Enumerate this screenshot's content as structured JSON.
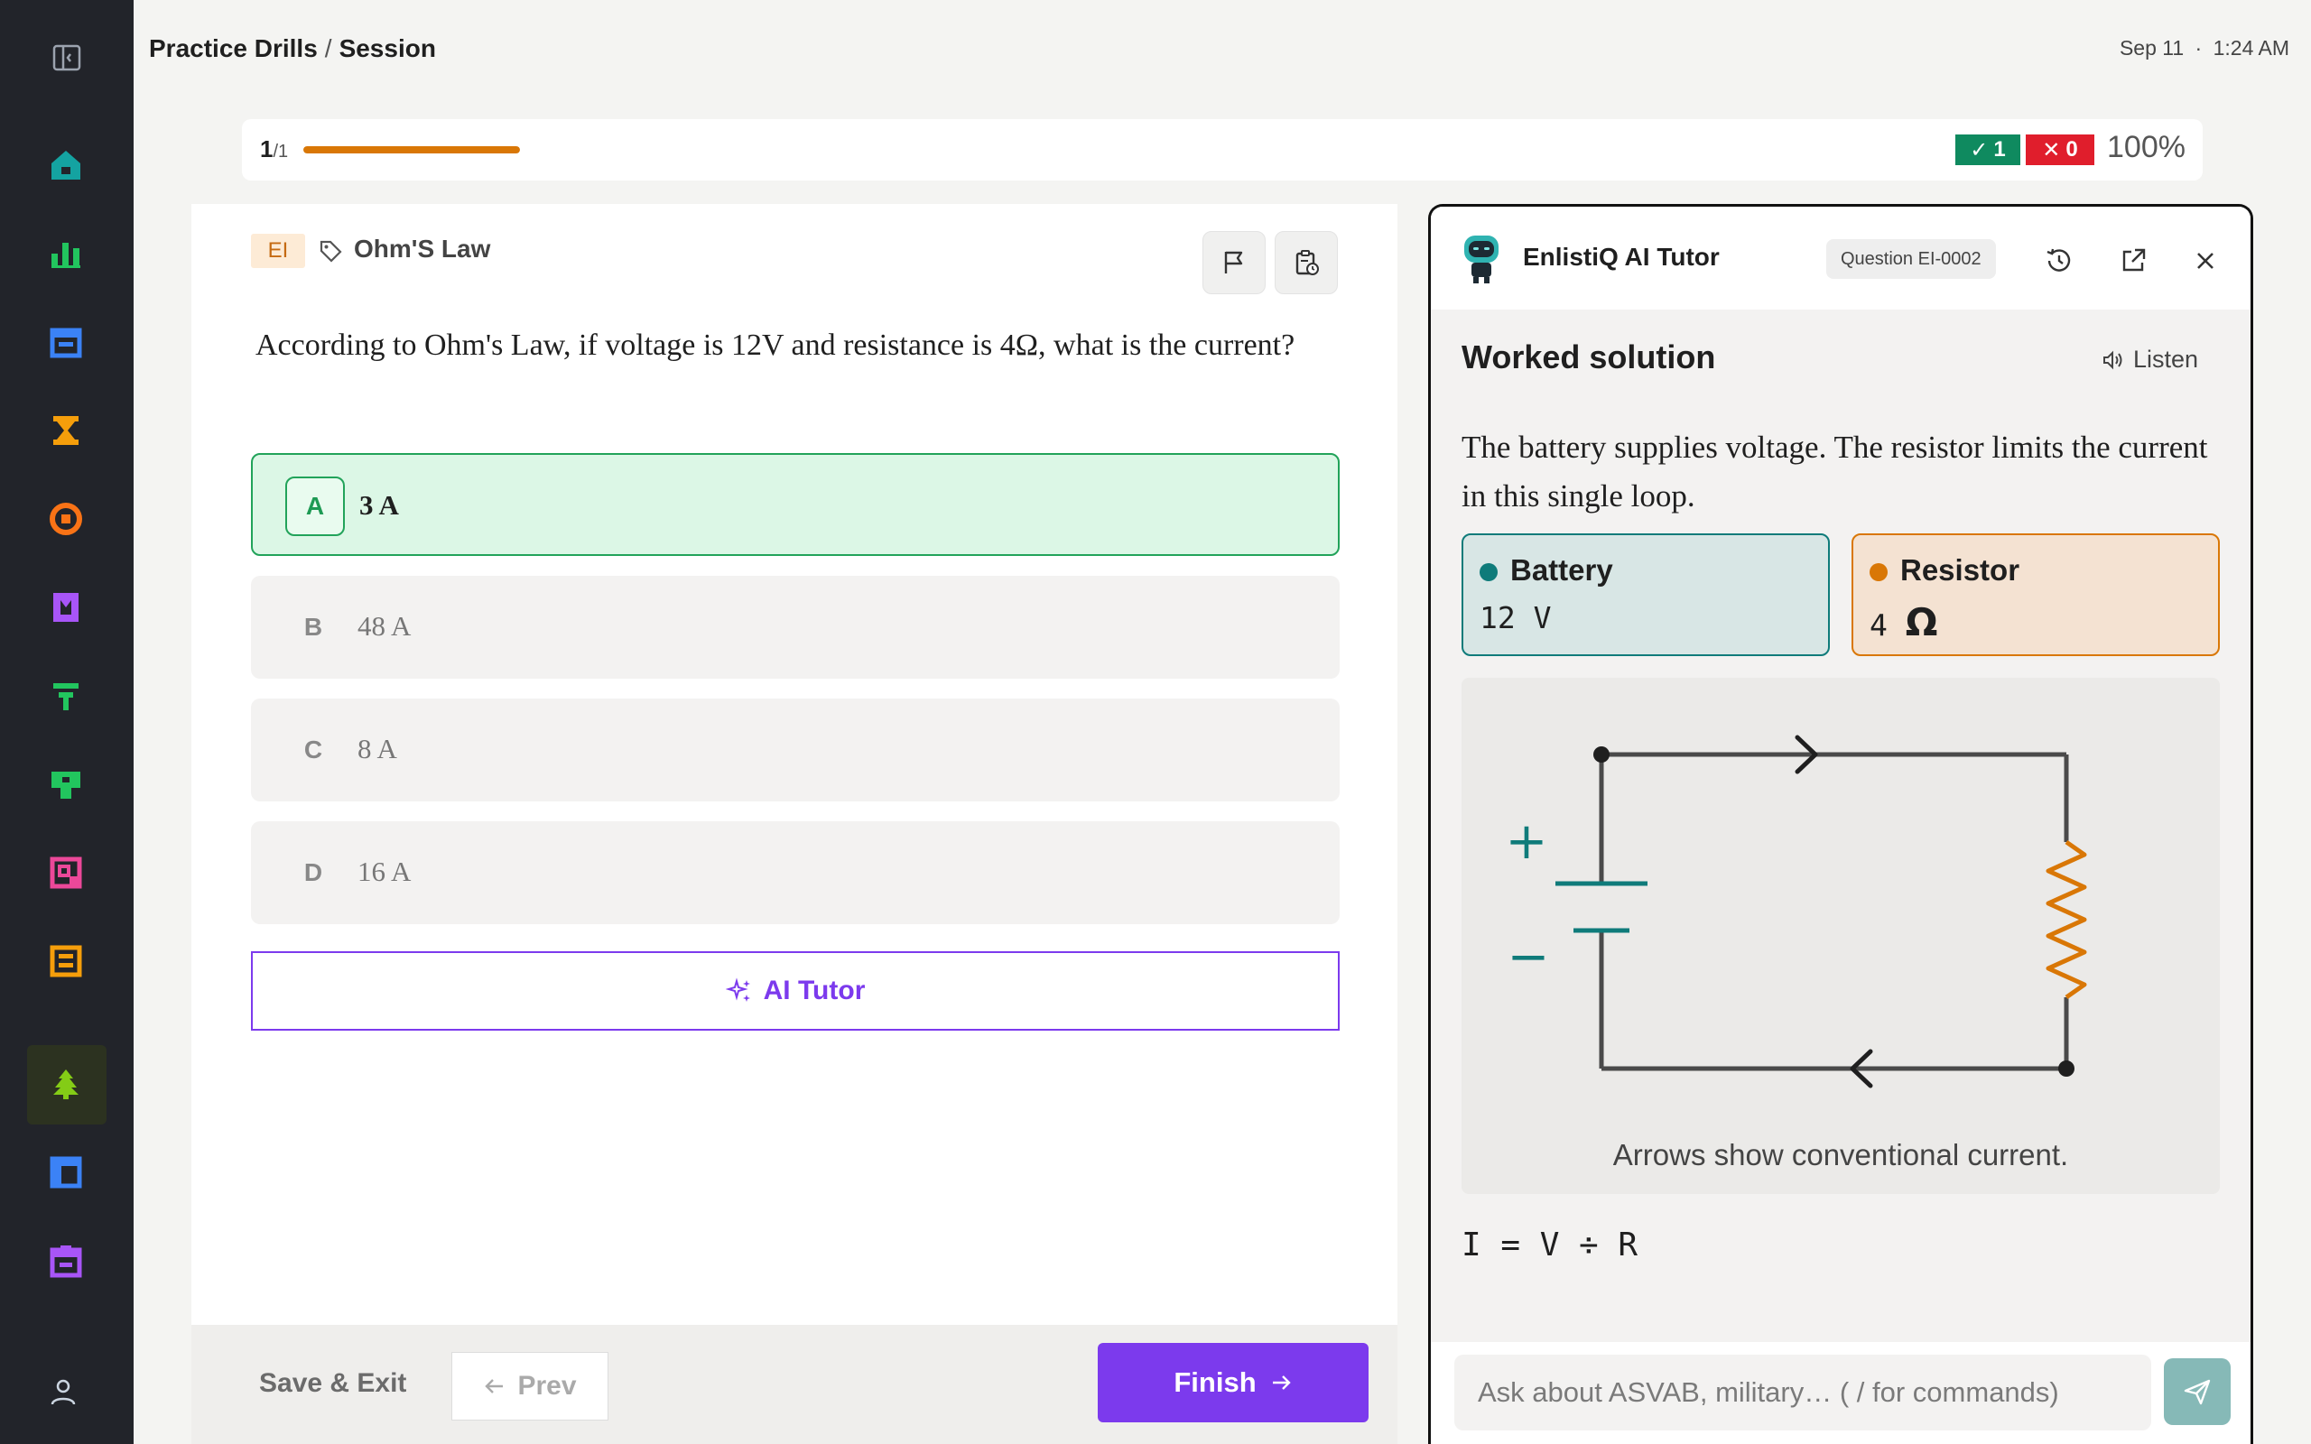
{
  "header": {
    "breadcrumb_section": "Practice Drills",
    "breadcrumb_separator": "/",
    "breadcrumb_page": "Session",
    "date": "Sep 11",
    "date_sep": "·",
    "time": "1:24 AM"
  },
  "sidebar": {
    "items": [
      {
        "name": "home",
        "color": "#14a3a1"
      },
      {
        "name": "stats",
        "color": "#22c55e"
      },
      {
        "name": "calendar",
        "color": "#3b82f6"
      },
      {
        "name": "trophy",
        "color": "#f59e0b"
      },
      {
        "name": "target",
        "color": "#f97316"
      },
      {
        "name": "book",
        "color": "#a855f7"
      },
      {
        "name": "arrow-up",
        "color": "#22c55e"
      },
      {
        "name": "shield",
        "color": "#22c55e"
      },
      {
        "name": "document",
        "color": "#ec4899"
      },
      {
        "name": "grid",
        "color": "#f59e0b"
      },
      {
        "name": "tree",
        "color": "#84cc16",
        "active": true
      },
      {
        "name": "layout",
        "color": "#3b82f6"
      },
      {
        "name": "box",
        "color": "#a855f7"
      }
    ]
  },
  "progress": {
    "current": "1",
    "total": "/1",
    "fraction": 1.0,
    "correct_count": "1",
    "wrong_count": "0",
    "percent": "100%",
    "bar_color": "#d97706"
  },
  "question": {
    "category_tag": "EI",
    "topic": "Ohm'S Law",
    "text": "According to Ohm's Law, if voltage is 12V and resistance is 4Ω, what is the current?",
    "options": [
      {
        "letter": "A",
        "text": "3 A",
        "selected": true
      },
      {
        "letter": "B",
        "text": "48 A"
      },
      {
        "letter": "C",
        "text": "8 A"
      },
      {
        "letter": "D",
        "text": "16 A"
      }
    ],
    "ai_tutor_label": "AI Tutor"
  },
  "footer": {
    "save_exit_label": "Save & Exit",
    "prev_label": "Prev",
    "finish_label": "Finish"
  },
  "tutor": {
    "name": "EnlistiQ AI Tutor",
    "question_id": "Question EI-0002",
    "section_title": "Worked solution",
    "listen_label": "Listen",
    "explanation": "The battery supplies voltage. The resistor limits the current in this single loop.",
    "battery": {
      "label": "Battery",
      "value": "12 V",
      "color": "#0f7b7a"
    },
    "resistor": {
      "label": "Resistor",
      "value_num": "4",
      "value_unit": "Ω",
      "color": "#d97706"
    },
    "circuit_plus": "+",
    "circuit_minus": "−",
    "caption": "Arrows show conventional current.",
    "formula": "I = V ÷ R",
    "input_placeholder": "Ask about ASVAB, military… ( / for commands)"
  }
}
